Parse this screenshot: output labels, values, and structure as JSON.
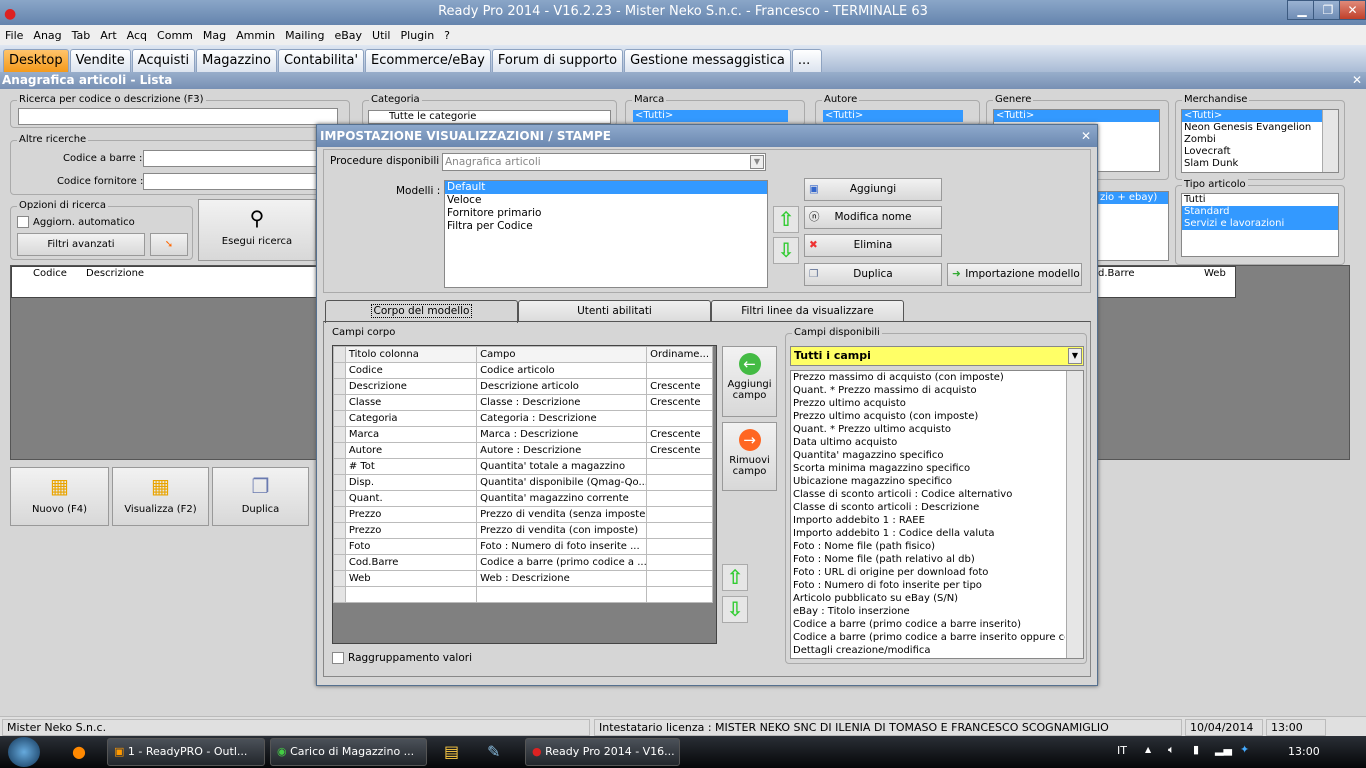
{
  "window": {
    "title": "Ready Pro 2014 - V16.2.23 - Mister Neko S.n.c. - Francesco - TERMINALE 63",
    "min": "▁",
    "max": "❐",
    "close": "✕"
  },
  "menu": [
    "File",
    "Anag",
    "Tab",
    "Art",
    "Acq",
    "Comm",
    "Mag",
    "Ammin",
    "Mailing",
    "eBay",
    "Util",
    "Plugin",
    "?"
  ],
  "tabs": [
    "Desktop",
    "Vendite",
    "Acquisti",
    "Magazzino",
    "Contabilita'",
    "Ecommerce/eBay",
    "Forum di supporto",
    "Gestione messaggistica",
    "..."
  ],
  "subheader": {
    "title": "Anagrafica articoli  - Lista",
    "close": "✕"
  },
  "search": {
    "label": "Ricerca per codice o descrizione (F3)",
    "value": "",
    "altre": "Altre ricerche",
    "barcode_label": "Codice a barre :",
    "supplier_label": "Codice fornitore :",
    "options": "Opzioni di ricerca",
    "auto": "Aggiorn. automatico",
    "filters": "Filtri avanzati",
    "run": "Esegui ricerca"
  },
  "filters": {
    "categoria": {
      "label": "Categoria",
      "value": "Tutte le categorie"
    },
    "marca": {
      "label": "Marca",
      "value": "<Tutti>"
    },
    "autore": {
      "label": "Autore",
      "value": "<Tutti>"
    },
    "genere": {
      "label": "Genere",
      "value": "<Tutti>"
    },
    "merchandise": {
      "label": "Merchandise",
      "items": [
        "<Tutti>",
        "Neon Genesis Evangelion",
        "Zombi",
        "Lovecraft",
        "Slam Dunk"
      ]
    },
    "extra_value": "zio + ebay)",
    "tipo": {
      "label": "Tipo articolo",
      "items": [
        "Tutti",
        "Standard",
        "Servizi e lavorazioni"
      ]
    }
  },
  "grid": {
    "columns": [
      "Codice",
      "Descrizione"
    ],
    "right_columns": [
      "d.Barre",
      "Web"
    ]
  },
  "actions": [
    "Nuovo (F4)",
    "Visualizza (F2)",
    "Duplica"
  ],
  "dialog": {
    "title": "IMPOSTAZIONE VISUALIZZAZIONI / STAMPE",
    "close": "✕",
    "procedure_label": "Procedure disponibili :",
    "procedure_value": "Anagrafica articoli",
    "models_label": "Modelli :",
    "models": [
      "Default",
      "Veloce",
      "Fornitore primario",
      "Filtra per Codice"
    ],
    "buttons": {
      "add": "Aggiungi",
      "rename": "Modifica nome",
      "delete": "Elimina",
      "duplicate": "Duplica",
      "import": "Importazione modello"
    },
    "tabs": [
      "Corpo del modello",
      "Utenti abilitati",
      "Filtri linee da visualizzare"
    ],
    "body_label": "Campi corpo",
    "columns": [
      "Titolo colonna",
      "Campo",
      "Ordiname..."
    ],
    "rows": [
      [
        "Codice",
        "Codice articolo",
        ""
      ],
      [
        "Descrizione",
        "Descrizione articolo",
        "Crescente"
      ],
      [
        "Classe",
        "Classe : Descrizione",
        "Crescente"
      ],
      [
        "Categoria",
        "Categoria : Descrizione",
        ""
      ],
      [
        "Marca",
        "Marca : Descrizione",
        "Crescente"
      ],
      [
        "Autore",
        "Autore : Descrizione",
        "Crescente"
      ],
      [
        "# Tot",
        "Quantita' totale a magazzino",
        ""
      ],
      [
        "Disp.",
        "Quantita' disponibile (Qmag-Qo...",
        ""
      ],
      [
        "Quant.",
        "Quantita' magazzino corrente",
        ""
      ],
      [
        "Prezzo",
        "Prezzo di vendita (senza imposte)",
        ""
      ],
      [
        "Prezzo",
        "Prezzo di vendita (con imposte)",
        ""
      ],
      [
        "Foto",
        "Foto : Numero di foto inserite ...",
        ""
      ],
      [
        "Cod.Barre",
        "Codice a barre (primo codice a ...",
        ""
      ],
      [
        "Web",
        "Web : Descrizione",
        ""
      ]
    ],
    "add_field": "Aggiungi campo",
    "remove_field": "Rimuovi campo",
    "available_label": "Campi disponibili",
    "available_filter": "Tutti i campi",
    "available": [
      "Prezzo massimo di acquisto (con imposte)",
      "Quant. * Prezzo massimo di acquisto",
      "Prezzo ultimo acquisto",
      "Prezzo ultimo acquisto (con imposte)",
      "Quant. * Prezzo ultimo acquisto",
      "Data ultimo acquisto",
      "Quantita' magazzino specifico",
      "Scorta minima magazzino specifico",
      "Ubicazione magazzino specifico",
      "Classe di sconto articoli : Codice alternativo",
      "Classe di sconto articoli : Descrizione",
      "Importo addebito 1 : RAEE",
      "Importo addebito 1 : Codice della valuta",
      "Foto : Nome file (path fisico)",
      "Foto : Nome file (path relativo al db)",
      "Foto : URL di origine per download foto",
      "Foto : Numero di foto inserite per tipo",
      "Articolo pubblicato su eBay (S/N)",
      "eBay : Titolo inserzione",
      "Codice a barre (primo codice a barre inserito)",
      "Codice a barre (primo codice a barre inserito oppure codi",
      "Dettagli creazione/modifica"
    ],
    "grouping": "Raggruppamento valori"
  },
  "status": {
    "company": "Mister Neko S.n.c.",
    "license": "Intestatario licenza : MISTER NEKO SNC DI ILENIA DI TOMASO E FRANCESCO SCOGNAMIGLIO",
    "date": "10/04/2014",
    "time": "13:00"
  },
  "taskbar": {
    "items": [
      "1 - ReadyPRO - Outl...",
      "Carico di Magazzino ...",
      "Ready Pro 2014 - V16..."
    ],
    "lang": "IT",
    "clock": "13:00"
  }
}
